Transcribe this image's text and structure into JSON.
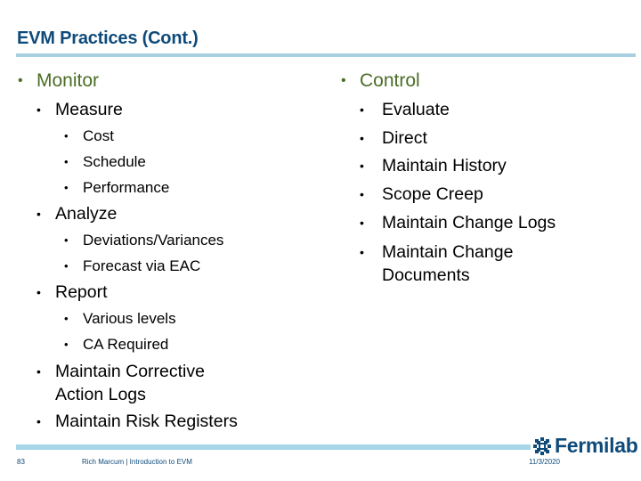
{
  "slide": {
    "title": "EVM Practices (Cont.)",
    "bullet": "•"
  },
  "left": {
    "heading": "Monitor",
    "items": [
      {
        "label": "Measure",
        "subitems": [
          "Cost",
          "Schedule",
          "Performance"
        ]
      },
      {
        "label": "Analyze",
        "subitems": [
          "Deviations/Variances",
          "Forecast via EAC"
        ]
      },
      {
        "label": "Report",
        "subitems": [
          "Various levels",
          "CA Required"
        ]
      },
      {
        "label": "Maintain Corrective Action Logs",
        "subitems": []
      },
      {
        "label": "Maintain Risk Registers",
        "subitems": []
      }
    ]
  },
  "right": {
    "heading": "Control",
    "items": [
      "Evaluate",
      "Direct",
      "Maintain History",
      "Scope Creep",
      "Maintain Change Logs",
      "Maintain Change Documents"
    ]
  },
  "footer": {
    "page_number": "83",
    "author_title": "Rich Marcum | Introduction to EVM",
    "date": "11/3/2020",
    "logo_text": "Fermilab",
    "logo_icon": "fermilab-logo-icon"
  },
  "colors": {
    "title": "#0e4a7a",
    "heading_green": "#4a6d25",
    "rule": "#a6d6e8"
  }
}
